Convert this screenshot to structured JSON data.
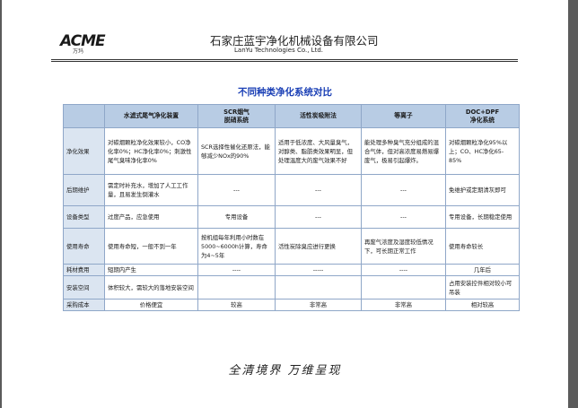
{
  "header": {
    "logo_text": "ACME",
    "logo_subtext": "万玛",
    "company_cn": "石家庄蓝宇净化机械设备有限公司",
    "company_en": "LanYu Technologies Co., Ltd."
  },
  "doc_title": "不同种类净化系统对比",
  "table": {
    "columns": [
      "",
      "水滤式尾气净化装置",
      "SCR烟气\n脱硝系统",
      "活性炭吸附法",
      "等离子",
      "DOC+DPF\n净化系统"
    ],
    "rows": [
      {
        "label": "净化效果",
        "cells": [
          "对碳烟颗粒净化效果较小，CO净化率0%；HC净化率0%；刺激性尾气臭味净化率0%",
          "SCR选择性催化还原法，能够减少NOx的90%",
          "适用于低浓度、大风量臭气，对醇类、脂肪类效果明显，但处理温度大的废气效果不好",
          "能处理多种臭气充分组成的混合气体，但对高浓度易燃易爆废气，极易引起爆炸。",
          "对碳烟颗粒净化95%以上；CO、HC净化65-85%"
        ]
      },
      {
        "label": "后期维护",
        "cells": [
          "需定时补充水，增加了人工工作量，且易发生倒灌水",
          "---",
          "---",
          "---",
          "免维护或定期清灰即可"
        ]
      },
      {
        "label": "设备类型",
        "cells": [
          "过度产品，应急使用",
          "专用设备",
          "---",
          "---",
          "专用设备，长期稳定使用"
        ]
      },
      {
        "label": "使用寿命",
        "cells": [
          "使用寿命短，一般不到一年",
          "按机组每年利用小时数在5000~6000h计算，寿命为4~5年",
          "活性炭除臭应进行更换",
          "再废气浓度及湿度较低情况下，可长期正常工作",
          "使用寿命较长"
        ]
      },
      {
        "label": "耗材费用",
        "cells": [
          "短期内产生",
          "----",
          "-----",
          "----",
          "几年后"
        ]
      },
      {
        "label": "安装空间",
        "cells": [
          "体积较大，需较大的落地安装空间",
          "",
          "",
          "",
          "占用安装控件相对较小可吊装"
        ]
      },
      {
        "label": "采购成本",
        "cells": [
          "价格便宜",
          "较高",
          "非常高",
          "非常高",
          "相对较高"
        ]
      }
    ]
  },
  "footer_slogan": "全清境界  万维呈现"
}
